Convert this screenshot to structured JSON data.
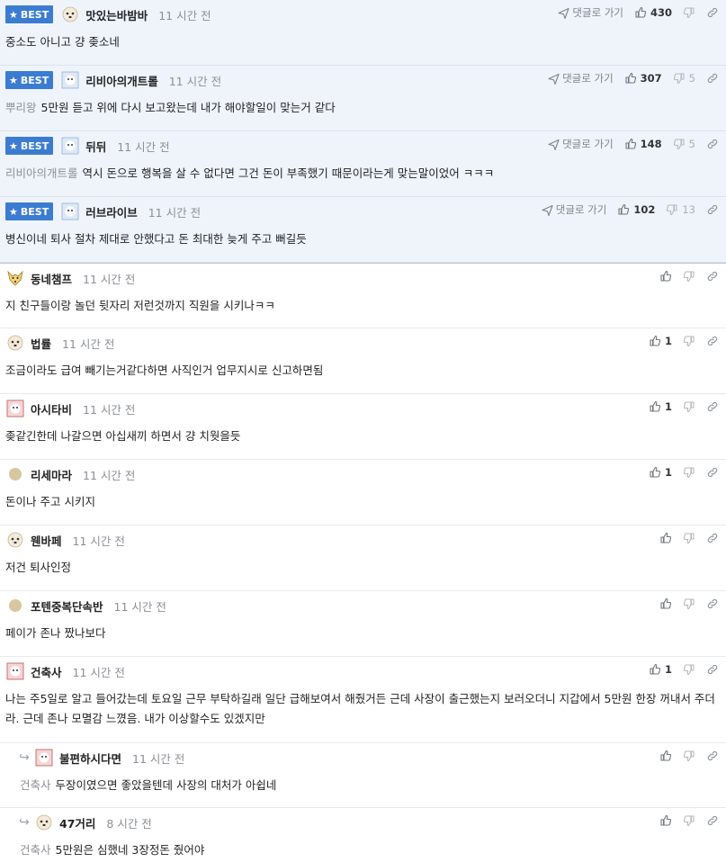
{
  "labels": {
    "best": "BEST",
    "goto_reply": "댓글로 가기"
  },
  "icons": {
    "best_star": "★",
    "reply_arrow": "↪"
  },
  "colors": {
    "best_badge": "#3b7cd1",
    "best_background": "#eff4fb",
    "mention": "#8b8f96"
  },
  "comments": [
    {
      "best": true,
      "nick": "맛있는바밤바",
      "time": "11 시간 전",
      "mention": "",
      "text": "중소도 아니고 걍 좆소네",
      "likes": "430",
      "dislikes": ""
    },
    {
      "best": true,
      "nick": "리비아의개트롤",
      "time": "11 시간 전",
      "mention": "뿌리왕",
      "text": "5만원 듣고 위에 다시 보고왔는데 내가 해야할일이 맞는거 같다",
      "likes": "307",
      "dislikes": "5"
    },
    {
      "best": true,
      "nick": "뒤뒤",
      "time": "11 시간 전",
      "mention": "리비아의개트롤",
      "text": "역시 돈으로 행복을 살 수 없다면 그건 돈이 부족했기 때문이라는게 맞는말이었어 ㅋㅋㅋ",
      "likes": "148",
      "dislikes": "5"
    },
    {
      "best": true,
      "nick": "러브라이브",
      "time": "11 시간 전",
      "mention": "",
      "text": "병신이네 퇴사 절차 제대로 안했다고 돈 최대한 늦게 주고 뻐길듯",
      "likes": "102",
      "dislikes": "13"
    },
    {
      "best": false,
      "nick": "동네챔프",
      "time": "11 시간 전",
      "mention": "",
      "text": "지 친구들이랑 놀던 뒷자리 저런것까지 직원을 시키나ㅋㅋ",
      "likes": "",
      "dislikes": ""
    },
    {
      "best": false,
      "nick": "법률",
      "time": "11 시간 전",
      "mention": "",
      "text": "조금이라도 급여 빼기는거같다하면 사직인거 업무지시로 신고하면됨",
      "likes": "1",
      "dislikes": ""
    },
    {
      "best": false,
      "nick": "아시타비",
      "time": "11 시간 전",
      "mention": "",
      "text": "좆같긴한데 나갈으면 아십새끼 하면서 걍 치웟을듯",
      "likes": "1",
      "dislikes": ""
    },
    {
      "best": false,
      "nick": "리세마라",
      "time": "11 시간 전",
      "mention": "",
      "text": "돈이나 주고 시키지",
      "likes": "1",
      "dislikes": ""
    },
    {
      "best": false,
      "nick": "웬바페",
      "time": "11 시간 전",
      "mention": "",
      "text": "저건 퇴사인정",
      "likes": "",
      "dislikes": ""
    },
    {
      "best": false,
      "nick": "포텐중복단속반",
      "time": "11 시간 전",
      "mention": "",
      "text": "페이가 존나 짰나보다",
      "likes": "",
      "dislikes": ""
    },
    {
      "best": false,
      "nick": "건축사",
      "time": "11 시간 전",
      "mention": "",
      "text": "나는 주5일로 알고 들어갔는데 토요일 근무 부탁하길래 일단 급해보여서 해줬거든 근데 사장이 출근했는지 보러오더니 지갑에서 5만원 한장 꺼내서 주더라. 근데 존나 모멸감 느꼈음. 내가 이상할수도 있겠지만",
      "likes": "1",
      "dislikes": ""
    },
    {
      "best": false,
      "reply": true,
      "nick": "불편하시다면",
      "time": "11 시간 전",
      "mention": "건축사",
      "text": "두장이였으면 좋았을텐데 사장의 대처가 아쉽네",
      "likes": "",
      "dislikes": ""
    },
    {
      "best": false,
      "reply": true,
      "nick": "47거리",
      "time": "8 시간 전",
      "mention": "건축사",
      "text": "5만원은 심했네 3장정돈 줬어야",
      "likes": "",
      "dislikes": ""
    }
  ]
}
